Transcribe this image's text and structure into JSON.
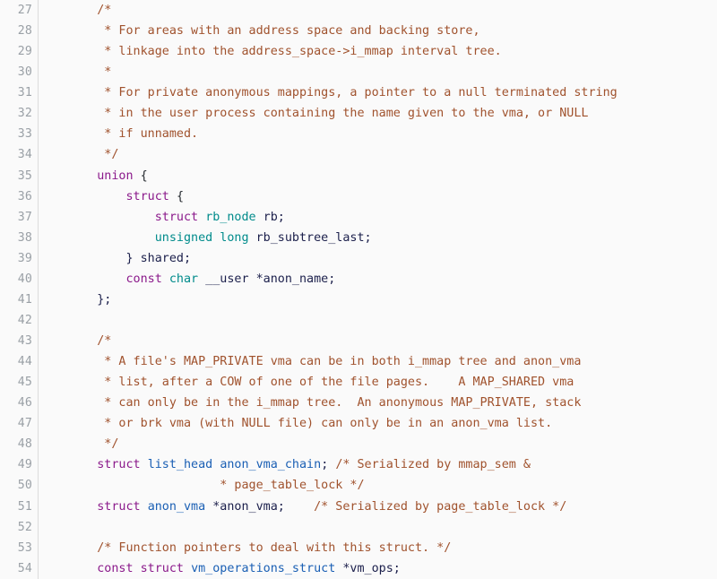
{
  "viewer": {
    "title": "Source code viewer",
    "language": "C",
    "first_line": 27,
    "last_line": 54,
    "colors": {
      "background": "#fafafa",
      "gutter_background": "#fafafa",
      "gutter_border": "#dcdcdc",
      "line_number": "#9aa0a6",
      "comment": "#a0522d",
      "keyword": "#8b1a8b",
      "type": "#008b8b",
      "identifier": "#1a5fb4",
      "plain": "#1b1f4b",
      "punctuation": "#24292e"
    }
  },
  "lines": [
    {
      "number": "27",
      "tokens": [
        {
          "t": "    ",
          "c": "plain"
        },
        {
          "t": "/*",
          "c": "comment"
        }
      ]
    },
    {
      "number": "28",
      "tokens": [
        {
          "t": "     * For areas with an address space and backing store,",
          "c": "comment"
        }
      ]
    },
    {
      "number": "29",
      "tokens": [
        {
          "t": "     * linkage into the address_space->i_mmap interval tree.",
          "c": "comment"
        }
      ]
    },
    {
      "number": "30",
      "tokens": [
        {
          "t": "     *",
          "c": "comment"
        }
      ]
    },
    {
      "number": "31",
      "tokens": [
        {
          "t": "     * For private anonymous mappings, a pointer to a null terminated string",
          "c": "comment"
        }
      ]
    },
    {
      "number": "32",
      "tokens": [
        {
          "t": "     * in the user process containing the name given to the vma, or NULL",
          "c": "comment"
        }
      ]
    },
    {
      "number": "33",
      "tokens": [
        {
          "t": "     * if unnamed.",
          "c": "comment"
        }
      ]
    },
    {
      "number": "34",
      "tokens": [
        {
          "t": "     */",
          "c": "comment"
        }
      ]
    },
    {
      "number": "35",
      "tokens": [
        {
          "t": "    ",
          "c": "plain"
        },
        {
          "t": "union",
          "c": "keyword"
        },
        {
          "t": " ",
          "c": "plain"
        },
        {
          "t": "{",
          "c": "punct"
        }
      ]
    },
    {
      "number": "36",
      "tokens": [
        {
          "t": "        ",
          "c": "plain"
        },
        {
          "t": "struct",
          "c": "keyword"
        },
        {
          "t": " ",
          "c": "plain"
        },
        {
          "t": "{",
          "c": "punct"
        }
      ]
    },
    {
      "number": "37",
      "tokens": [
        {
          "t": "            ",
          "c": "plain"
        },
        {
          "t": "struct",
          "c": "keyword"
        },
        {
          "t": " ",
          "c": "plain"
        },
        {
          "t": "rb_node",
          "c": "type"
        },
        {
          "t": " ",
          "c": "plain"
        },
        {
          "t": "rb;",
          "c": "plain"
        }
      ]
    },
    {
      "number": "38",
      "tokens": [
        {
          "t": "            ",
          "c": "plain"
        },
        {
          "t": "unsigned long",
          "c": "type"
        },
        {
          "t": " ",
          "c": "plain"
        },
        {
          "t": "rb_subtree_last;",
          "c": "plain"
        }
      ]
    },
    {
      "number": "39",
      "tokens": [
        {
          "t": "        } shared;",
          "c": "plain"
        }
      ]
    },
    {
      "number": "40",
      "tokens": [
        {
          "t": "        ",
          "c": "plain"
        },
        {
          "t": "const",
          "c": "keyword"
        },
        {
          "t": " ",
          "c": "plain"
        },
        {
          "t": "char",
          "c": "type"
        },
        {
          "t": " __user *anon_name;",
          "c": "plain"
        }
      ]
    },
    {
      "number": "41",
      "tokens": [
        {
          "t": "    };",
          "c": "plain"
        }
      ]
    },
    {
      "number": "42",
      "tokens": [
        {
          "t": "",
          "c": "plain"
        }
      ]
    },
    {
      "number": "43",
      "tokens": [
        {
          "t": "    ",
          "c": "plain"
        },
        {
          "t": "/*",
          "c": "comment"
        }
      ]
    },
    {
      "number": "44",
      "tokens": [
        {
          "t": "     * A file's MAP_PRIVATE vma can be in both i_mmap tree and anon_vma",
          "c": "comment"
        }
      ]
    },
    {
      "number": "45",
      "tokens": [
        {
          "t": "     * list, after a COW of one of the file pages.    A MAP_SHARED vma",
          "c": "comment"
        }
      ]
    },
    {
      "number": "46",
      "tokens": [
        {
          "t": "     * can only be in the i_mmap tree.  An anonymous MAP_PRIVATE, stack",
          "c": "comment"
        }
      ]
    },
    {
      "number": "47",
      "tokens": [
        {
          "t": "     * or brk vma (with NULL file) can only be in an anon_vma list.",
          "c": "comment"
        }
      ]
    },
    {
      "number": "48",
      "tokens": [
        {
          "t": "     */",
          "c": "comment"
        }
      ]
    },
    {
      "number": "49",
      "tokens": [
        {
          "t": "    ",
          "c": "plain"
        },
        {
          "t": "struct",
          "c": "keyword"
        },
        {
          "t": " ",
          "c": "plain"
        },
        {
          "t": "list_head",
          "c": "ident"
        },
        {
          "t": " ",
          "c": "plain"
        },
        {
          "t": "anon_vma_chain",
          "c": "ident"
        },
        {
          "t": "; ",
          "c": "plain"
        },
        {
          "t": "/* Serialized by mmap_sem &",
          "c": "comment"
        }
      ]
    },
    {
      "number": "50",
      "tokens": [
        {
          "t": "                     * page_table_lock */",
          "c": "comment"
        }
      ]
    },
    {
      "number": "51",
      "tokens": [
        {
          "t": "    ",
          "c": "plain"
        },
        {
          "t": "struct",
          "c": "keyword"
        },
        {
          "t": " ",
          "c": "plain"
        },
        {
          "t": "anon_vma",
          "c": "ident"
        },
        {
          "t": " *anon_vma;    ",
          "c": "plain"
        },
        {
          "t": "/* Serialized by page_table_lock */",
          "c": "comment"
        }
      ]
    },
    {
      "number": "52",
      "tokens": [
        {
          "t": "",
          "c": "plain"
        }
      ]
    },
    {
      "number": "53",
      "tokens": [
        {
          "t": "    ",
          "c": "plain"
        },
        {
          "t": "/* Function pointers to deal with this struct. */",
          "c": "comment"
        }
      ]
    },
    {
      "number": "54",
      "tokens": [
        {
          "t": "    ",
          "c": "plain"
        },
        {
          "t": "const",
          "c": "keyword"
        },
        {
          "t": " ",
          "c": "plain"
        },
        {
          "t": "struct",
          "c": "keyword"
        },
        {
          "t": " ",
          "c": "plain"
        },
        {
          "t": "vm_operations_struct",
          "c": "ident"
        },
        {
          "t": " *vm_ops;",
          "c": "plain"
        }
      ]
    }
  ]
}
